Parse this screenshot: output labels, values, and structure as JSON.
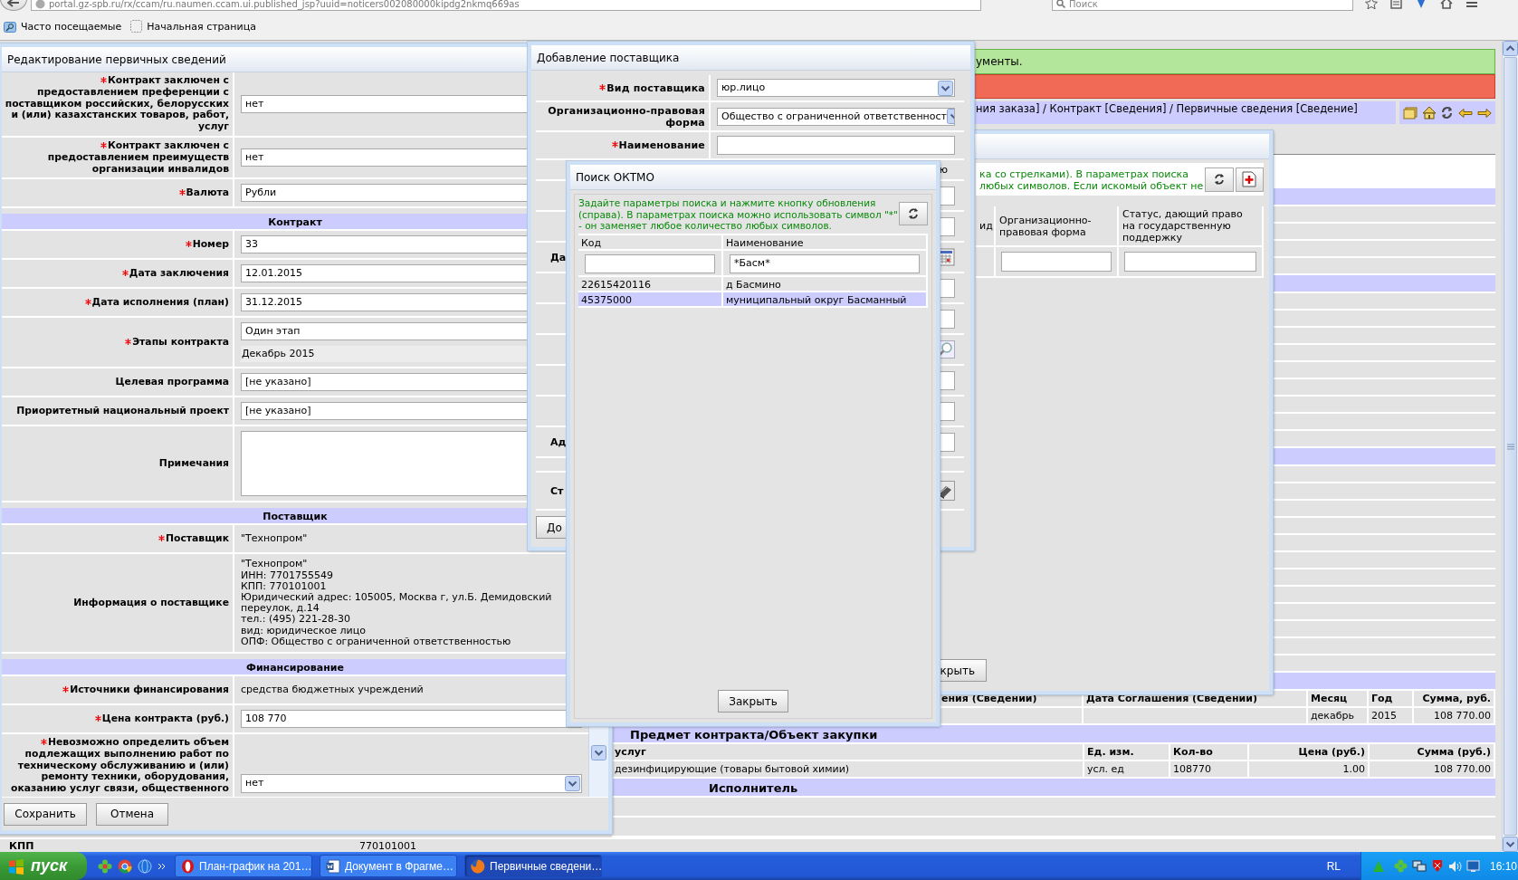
{
  "browser": {
    "url": "portal.gz-spb.ru/rx/ccam/ru.naumen.ccam.ui.published_jsp?uuid=noticers002080000kipdg2nkmq669as",
    "search_placeholder": "Поиск",
    "bookmarks": [
      "Часто посещаемые",
      "Начальная страница"
    ]
  },
  "page": {
    "notice": "ументы.",
    "breadcrumb": "ния заказа] / Контракт [Сведения] / Первичные сведения [Сведение]",
    "finance_table": {
      "columns": [
        "ения (Сведений)",
        "Дата Соглашения (Сведений)",
        "Месяц",
        "Год",
        "Сумма, руб."
      ],
      "rows": [
        {
          "month": "декабрь",
          "year": "2015",
          "sum": "108 770.00"
        }
      ]
    },
    "subject_title": "Предмет контракта/Объект закупки",
    "subject_table": {
      "columns": [
        "услуг",
        "Ед. изм.",
        "Кол-во",
        "Цена (руб.)",
        "Сумма (руб.)"
      ],
      "rows": [
        [
          "дезинфицирующие (товары бытовой химии)",
          "усл. ед",
          "108770",
          "1.00",
          "108 770.00"
        ]
      ]
    },
    "executor_title": "Исполнитель",
    "kpp": {
      "label": "КПП",
      "value": "770101001"
    }
  },
  "edit_window": {
    "title": "Редактирование первичных сведений",
    "rows": [
      {
        "kind": "field",
        "required": true,
        "label": "Контракт заключен с предоставлением преференции с поставщиком российских, белорусских и (или) казахстанских товаров, работ, услуг",
        "value": "нет"
      },
      {
        "kind": "field",
        "required": true,
        "label": "Контракт заключен с предоставлением преимуществ организации инвалидов",
        "value": "нет"
      },
      {
        "kind": "field",
        "required": true,
        "label": "Валюта",
        "value": "Рубли"
      },
      {
        "kind": "section",
        "label": "Контракт"
      },
      {
        "kind": "field",
        "required": true,
        "label": "Номер",
        "value": "33"
      },
      {
        "kind": "field",
        "required": true,
        "label": "Дата заключения",
        "value": "12.01.2015"
      },
      {
        "kind": "field",
        "required": true,
        "label": "Дата исполнения (план)",
        "value": "31.12.2015"
      },
      {
        "kind": "stages",
        "required": true,
        "label": "Этапы контракта",
        "value": "Один этап",
        "note": "Декабрь 2015"
      },
      {
        "kind": "field",
        "required": false,
        "label": "Целевая программа",
        "value": "[не указано]"
      },
      {
        "kind": "field",
        "required": false,
        "label": "Приоритетный национальный проект",
        "value": "[не указано]"
      },
      {
        "kind": "textarea",
        "required": false,
        "label": "Примечания"
      },
      {
        "kind": "section",
        "label": "Поставщик"
      },
      {
        "kind": "text",
        "required": true,
        "label": "Поставщик",
        "lines": [
          "\"Технопром\""
        ]
      },
      {
        "kind": "text",
        "required": false,
        "label": "Информация о поставщике",
        "lines": [
          "\"Технопром\"",
          "ИНН: 7701755549",
          "КПП: 770101001",
          "Юридический адрес: 105005, Москва г, ул.Б. Демидовский",
          "переулок, д.14",
          "тел.: (495) 221-28-30",
          "вид: юридическое лицо",
          "ОПФ: Общество с ограниченной ответственностью"
        ]
      },
      {
        "kind": "section",
        "label": "Финансирование"
      },
      {
        "kind": "text",
        "required": true,
        "label": "Источники финансирования",
        "lines": [
          "средства бюджетных учреждений"
        ]
      },
      {
        "kind": "field",
        "required": true,
        "label": "Цена контракта (руб.)",
        "value": "108 770"
      },
      {
        "kind": "select",
        "required": true,
        "label": "Невозможно определить объем подлежащих выполнению работ по техническому обслуживанию и (или) ремонту техники, оборудования, оказанию услуг связи, общественного",
        "value": "нет"
      }
    ],
    "buttons": [
      "Сохранить",
      "Отмена"
    ]
  },
  "supplier_search": {
    "hint_lines": [
      "ка со стрелками). В параметрах поиска",
      "любых символов. Если искомый объект не"
    ],
    "columns": [
      "ид",
      "Организационно-правовая форма",
      "Статус, дающий право на государственную поддержку"
    ],
    "close_button": "крыть"
  },
  "add_supplier": {
    "title": "Добавление поставщика",
    "rows": [
      {
        "kind": "select",
        "required": true,
        "label": "Вид поставщика",
        "value": "юр.лицо"
      },
      {
        "kind": "select",
        "required": false,
        "label": "Организационно-правовая форма",
        "value": "Общество с ограниченной ответственност"
      },
      {
        "kind": "field",
        "required": true,
        "label": "Наименование"
      },
      {
        "kind": "note",
        "text": "ю"
      },
      {
        "kind": "field"
      },
      {
        "kind": "field"
      },
      {
        "kind": "date",
        "label": "Да"
      },
      {
        "kind": "field"
      },
      {
        "kind": "field"
      },
      {
        "kind": "lookup"
      },
      {
        "kind": "field"
      },
      {
        "kind": "field"
      },
      {
        "kind": "field",
        "label": "Ад"
      },
      {
        "kind": "empty"
      },
      {
        "kind": "book",
        "label": "Ст"
      }
    ],
    "button": "До"
  },
  "oktmo": {
    "title": "Поиск ОКТМО",
    "hint_lines": [
      "Задайте параметры поиска и нажмите кнопку обновления",
      "(справа). В параметрах поиска можно использовать символ \"*\"",
      "- он заменяет любое количество любых символов."
    ],
    "columns": [
      "Код",
      "Наименование"
    ],
    "name_filter": "*Басм*",
    "rows": [
      {
        "code": "22615420116",
        "name": "д Басмино",
        "selected": false
      },
      {
        "code": "45375000",
        "name": "муниципальный округ Басманный",
        "selected": true
      }
    ],
    "close_button": "Закрыть"
  },
  "taskbar": {
    "start": "пуск",
    "tasks": [
      {
        "kind": "opera",
        "label": "План-график на 201…",
        "selected": false
      },
      {
        "kind": "word",
        "label": "Документ в Фрагме…",
        "selected": false
      },
      {
        "kind": "firefox",
        "label": "Первичные сведени…",
        "selected": true
      }
    ],
    "language": "RL",
    "clock": "16:10"
  }
}
